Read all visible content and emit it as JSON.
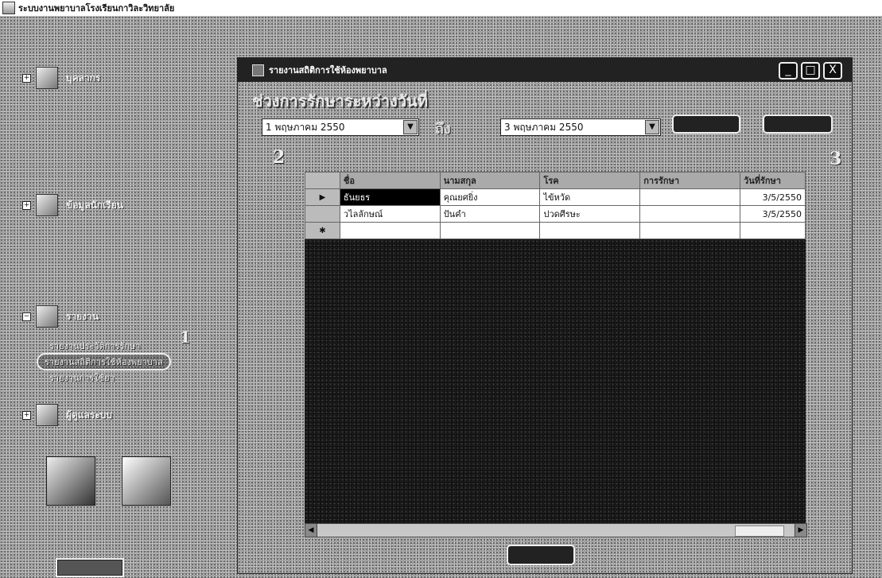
{
  "app": {
    "title": "ระบบงานพยาบาลโรงเรียนกาวิละวิทยาลัย"
  },
  "sidebar": {
    "items": [
      {
        "label": "บุคลากร",
        "expander": "+"
      },
      {
        "label": "ข้อมูลนักเรียน",
        "expander": "+"
      },
      {
        "label": "รายงาน",
        "expander": "−"
      },
      {
        "label": "ผู้ดูแลระบบ",
        "expander": "+"
      }
    ],
    "report_subitems": [
      "รายงานประวัติการรักษา",
      "รายงานสถิติการใช้ห้องพยาบาล",
      "รายงานการใช้ยา"
    ],
    "selected_subitem_index": 1,
    "logout_label": ""
  },
  "window": {
    "title": "รายงานสถิติการใช้ห้องพยาบาล",
    "controls": [
      "_",
      "□",
      "X"
    ],
    "range_heading": "ช่วงการรักษาระหว่างวันที่",
    "from_date": "1 พฤษภาคม  2550",
    "to_label": "ถึง",
    "to_date": "3 พฤษภาคม  2550",
    "callouts": [
      "2",
      "3"
    ],
    "sidebar_callout": "1",
    "close_label": ""
  },
  "grid": {
    "columns": [
      "ชื่อ",
      "นามสกุล",
      "โรค",
      "การรักษา",
      "วันที่รักษา"
    ],
    "rows": [
      {
        "first_name": "ธันยธร",
        "last_name": "คุณยศยิ่ง",
        "disease": "ไข้หวัด",
        "treatment": "",
        "date": "3/5/2550"
      },
      {
        "first_name": "วไลลักษณ์",
        "last_name": "ปันคำ",
        "disease": "ปวดศีรษะ",
        "treatment": "",
        "date": "3/5/2550"
      }
    ],
    "current_row_marker": "▶",
    "new_row_marker": "✱"
  },
  "colors": {
    "panel_dither": "#9a9a9a",
    "grid_background": "#101010",
    "window_titlebar": "#222222"
  }
}
